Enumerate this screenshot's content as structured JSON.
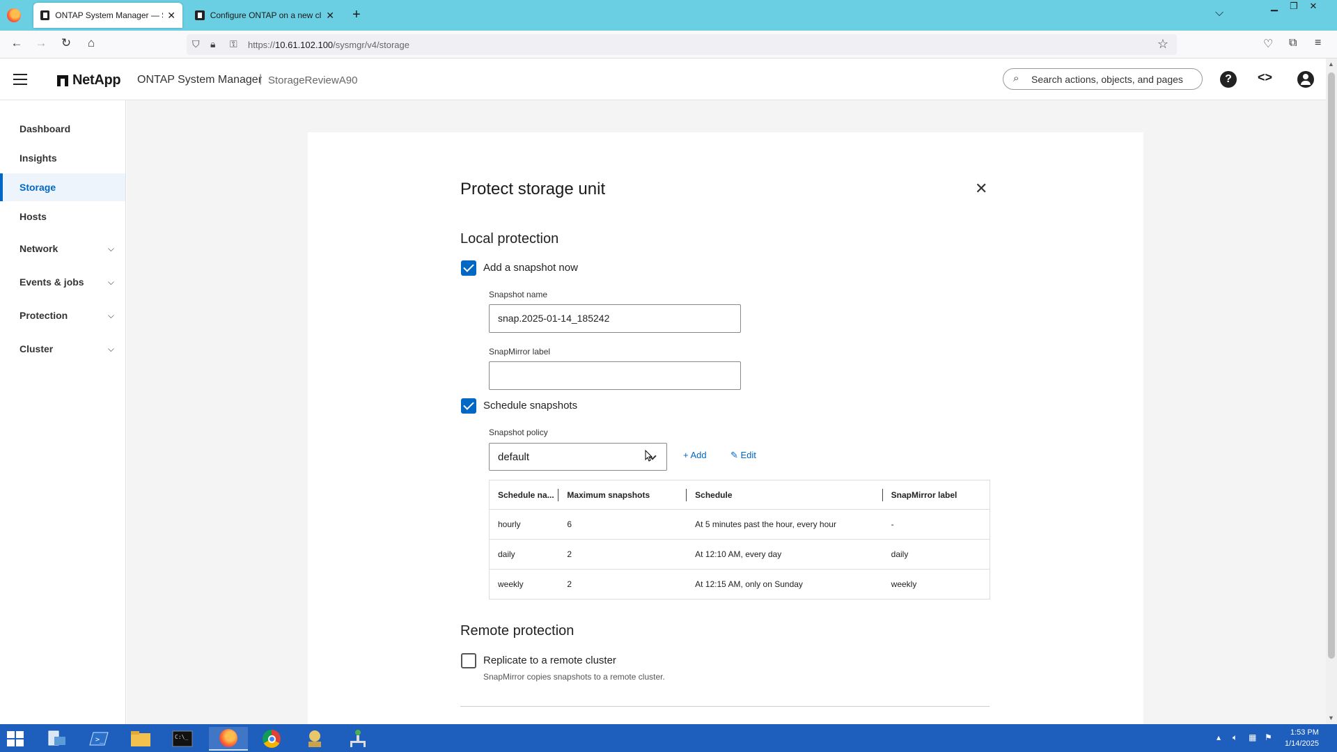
{
  "browser": {
    "tabs": [
      {
        "title": "ONTAP System Manager — Sto",
        "active": true
      },
      {
        "title": "Configure ONTAP on a new clu",
        "active": false
      }
    ],
    "url_prefix": "https://",
    "url_host": "10.61.102.100",
    "url_path": "/sysmgr/v4/storage"
  },
  "header": {
    "brand": "NetApp",
    "app_name": "ONTAP System Manager",
    "separator": "|",
    "cluster": "StorageReviewA90",
    "search_placeholder": "Search actions, objects, and pages"
  },
  "sidebar": {
    "items": [
      {
        "label": "Dashboard"
      },
      {
        "label": "Insights"
      },
      {
        "label": "Storage",
        "active": true
      },
      {
        "label": "Hosts"
      },
      {
        "label": "Network",
        "expandable": true
      },
      {
        "label": "Events & jobs",
        "expandable": true
      },
      {
        "label": "Protection",
        "expandable": true
      },
      {
        "label": "Cluster",
        "expandable": true
      }
    ]
  },
  "dialog": {
    "title": "Protect storage unit",
    "local_heading": "Local protection",
    "snapshot_now_label": "Add a snapshot now",
    "snapshot_now_checked": true,
    "snapshot_name_label": "Snapshot name",
    "snapshot_name_value": "snap.2025-01-14_185242",
    "snapmirror_label_label": "SnapMirror label",
    "snapmirror_label_value": "",
    "schedule_label": "Schedule snapshots",
    "schedule_checked": true,
    "policy_label": "Snapshot policy",
    "policy_value": "default",
    "add_label": "Add",
    "edit_label": "Edit",
    "table": {
      "headers": [
        "Schedule na...",
        "Maximum snapshots",
        "Schedule",
        "SnapMirror label"
      ],
      "rows": [
        [
          "hourly",
          "6",
          "At 5 minutes past the hour, every hour",
          "-"
        ],
        [
          "daily",
          "2",
          "At 12:10 AM, every day",
          "daily"
        ],
        [
          "weekly",
          "2",
          "At 12:15 AM, only on Sunday",
          "weekly"
        ]
      ]
    },
    "remote_heading": "Remote protection",
    "replicate_label": "Replicate to a remote cluster",
    "replicate_checked": false,
    "replicate_helper": "SnapMirror copies snapshots to a remote cluster."
  },
  "taskbar": {
    "time": "1:53 PM",
    "date": "1/14/2025"
  },
  "colors": {
    "accent": "#0067c5",
    "tabstrip": "#6bcfe3",
    "taskbar": "#1e5ebd"
  }
}
